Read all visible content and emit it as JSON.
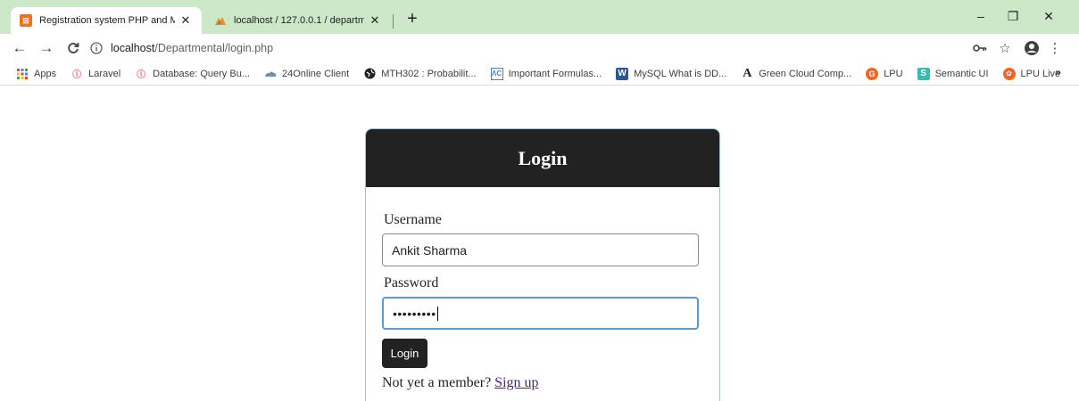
{
  "browser": {
    "tabs": [
      {
        "title": "Registration system PHP and My",
        "active": true
      },
      {
        "title": "localhost / 127.0.0.1 / departmen",
        "active": false
      }
    ],
    "new_tab_icon": "+",
    "window_controls": {
      "minimize": "–",
      "restore": "❐",
      "close": "✕"
    },
    "url_host": "localhost",
    "url_path": "/Departmental/login.php",
    "bookmarks": [
      {
        "label": "Apps",
        "icon": "apps-grid-icon"
      },
      {
        "label": "Laravel",
        "icon": "laravel-icon"
      },
      {
        "label": "Database: Query Bu...",
        "icon": "laravel-icon"
      },
      {
        "label": "24Online Client",
        "icon": "cloud-icon"
      },
      {
        "label": "MTH302 : Probabilit...",
        "icon": "globe-icon"
      },
      {
        "label": "Important Formulas...",
        "icon": "formula-icon"
      },
      {
        "label": "MySQL What is DD...",
        "icon": "word-icon"
      },
      {
        "label": "Green Cloud Comp...",
        "icon": "letter-a-icon"
      },
      {
        "label": "LPU",
        "icon": "lpu-icon"
      },
      {
        "label": "Semantic UI",
        "icon": "semantic-s-icon"
      },
      {
        "label": "LPU Live",
        "icon": "lpu-live-icon"
      }
    ],
    "more_bookmarks": "»"
  },
  "login": {
    "header": "Login",
    "username_label": "Username",
    "username_value": "Ankit Sharma",
    "password_label": "Password",
    "password_masked": "•••••••••",
    "submit_label": "Login",
    "signup_prompt": "Not yet a member?",
    "signup_link": "Sign up"
  },
  "colors": {
    "tabstrip_bg": "#cde8c9",
    "header_bg": "#222222",
    "button_bg": "#222222",
    "focus_border": "#5b9bd5",
    "link_visited": "#551a8b"
  }
}
